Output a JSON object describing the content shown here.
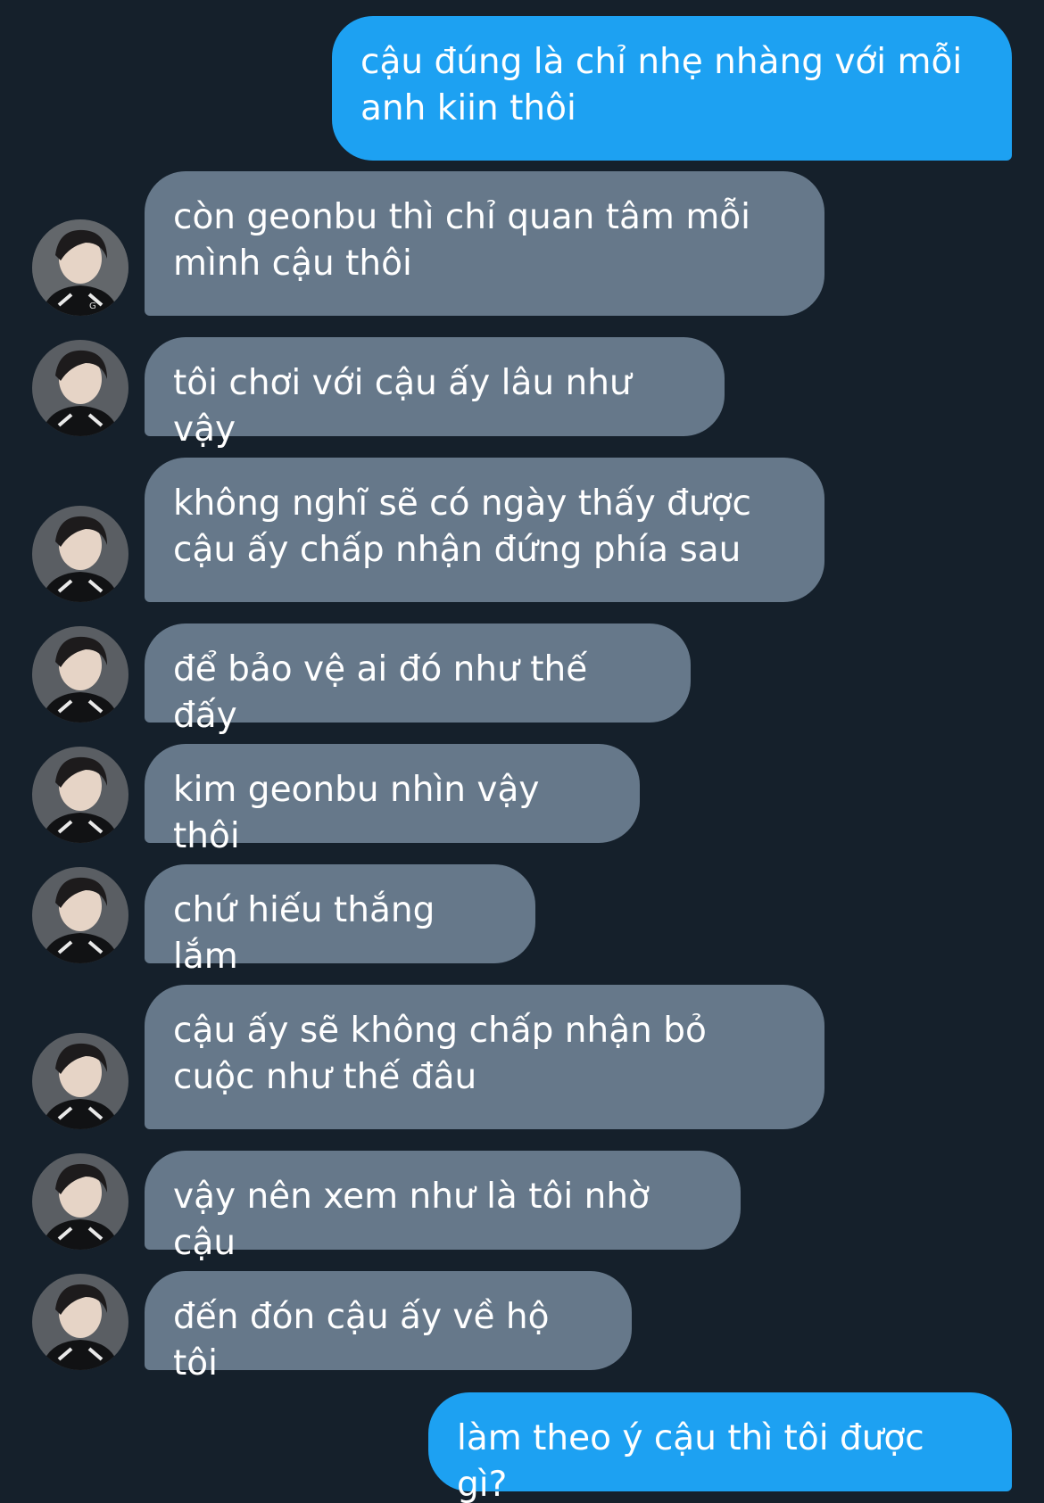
{
  "conversation": {
    "messages": [
      {
        "sender": "me",
        "text": "cậu đúng là chỉ nhẹ nhàng với mỗi anh kiin thôi"
      },
      {
        "sender": "them",
        "text": "còn geonbu thì chỉ quan tâm mỗi mình cậu thôi"
      },
      {
        "sender": "them",
        "text": "tôi chơi với cậu ấy lâu như vậy"
      },
      {
        "sender": "them",
        "text": "không nghĩ sẽ có ngày thấy được cậu ấy chấp nhận đứng phía sau"
      },
      {
        "sender": "them",
        "text": "để bảo vệ ai đó như thế đấy"
      },
      {
        "sender": "them",
        "text": "kim geonbu nhìn vậy thôi"
      },
      {
        "sender": "them",
        "text": "chứ hiếu thắng lắm"
      },
      {
        "sender": "them",
        "text": "cậu ấy sẽ không chấp nhận bỏ cuộc như thế đâu"
      },
      {
        "sender": "them",
        "text": "vậy nên xem như là tôi nhờ cậu"
      },
      {
        "sender": "them",
        "text": "đến đón cậu ấy về hộ tôi"
      },
      {
        "sender": "me",
        "text": "làm theo ý cậu thì tôi được gì?"
      }
    ]
  },
  "colors": {
    "background": "#15202b",
    "outgoing_bubble": "#1da1f2",
    "incoming_bubble": "#66788a",
    "text": "#ffffff"
  },
  "icons": {
    "avatar": "profile-photo-avatar"
  }
}
